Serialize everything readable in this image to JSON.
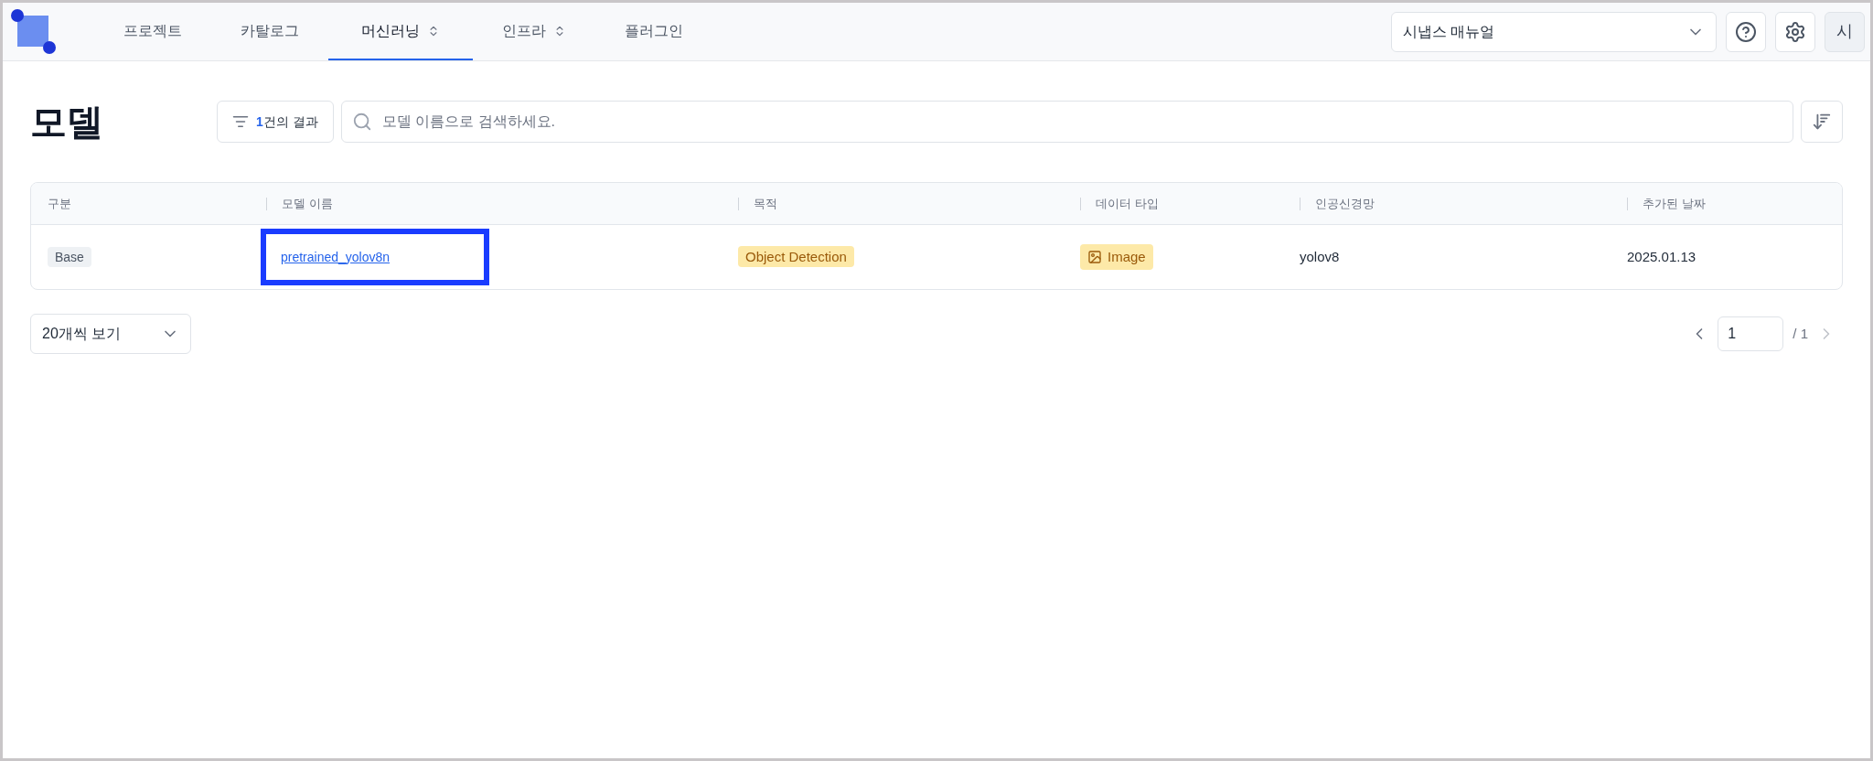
{
  "nav": {
    "tabs": [
      {
        "label": "프로젝트",
        "selected": false,
        "has_menu": false
      },
      {
        "label": "카탈로그",
        "selected": false,
        "has_menu": false
      },
      {
        "label": "머신러닝",
        "selected": true,
        "has_menu": true
      },
      {
        "label": "인프라",
        "selected": false,
        "has_menu": true
      },
      {
        "label": "플러그인",
        "selected": false,
        "has_menu": false
      }
    ],
    "manual_select": {
      "value": "시냅스 매뉴얼"
    },
    "avatar": "시"
  },
  "page": {
    "title": "모델",
    "filter": {
      "count": "1",
      "label": "건의 결과"
    },
    "search": {
      "placeholder": "모델 이름으로 검색하세요."
    }
  },
  "table": {
    "columns": [
      "구분",
      "모델 이름",
      "목적",
      "데이터 타입",
      "인공신경망",
      "추가된 날짜"
    ],
    "rows": [
      {
        "category": "Base",
        "name": "pretrained_yolov8n",
        "highlighted": true,
        "purpose": "Object Detection",
        "data_type": "Image",
        "network": "yolov8",
        "added": "2025.01.13"
      }
    ]
  },
  "pagination": {
    "page_size": "20개씩 보기",
    "page": "1",
    "total": "/ 1"
  }
}
